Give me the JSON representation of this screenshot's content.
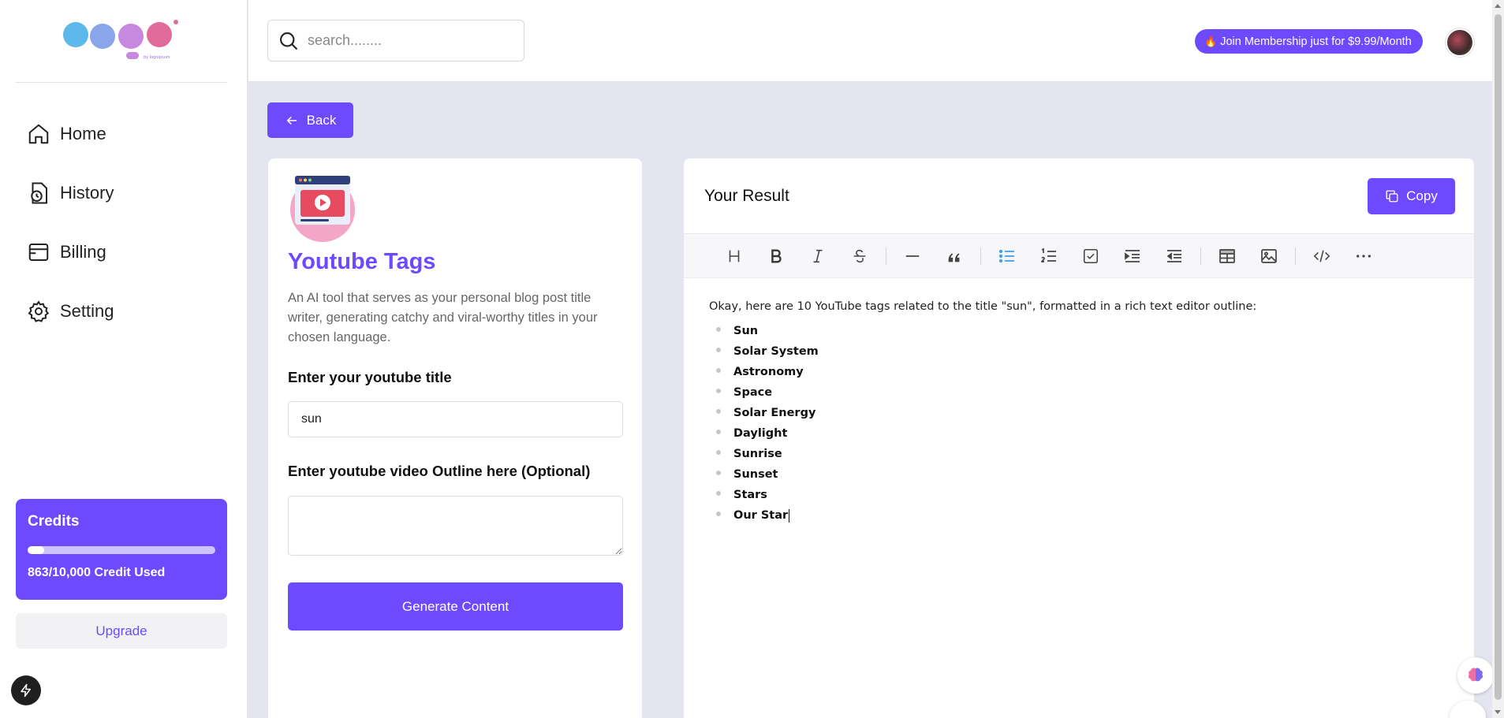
{
  "app": {
    "logo_text": "Logo",
    "logo_sub": "by logoipsum"
  },
  "sidebar": {
    "items": [
      {
        "label": "Home",
        "icon": "home-icon"
      },
      {
        "label": "History",
        "icon": "history-icon"
      },
      {
        "label": "Billing",
        "icon": "billing-icon"
      },
      {
        "label": "Setting",
        "icon": "gear-icon"
      }
    ],
    "credits": {
      "title": "Credits",
      "used_text": "863/10,000 Credit Used",
      "fraction_used": 0.0863
    },
    "upgrade_label": "Upgrade"
  },
  "topbar": {
    "search_placeholder": "search........",
    "membership_label": "Join Membership just for $9.99/Month"
  },
  "back_label": "Back",
  "tool": {
    "title": "Youtube Tags",
    "description": "An AI tool that serves as your personal blog post title writer, generating catchy and viral-worthy titles in your chosen language.",
    "title_field_label": "Enter your youtube title",
    "title_field_value": "sun",
    "outline_field_label": "Enter youtube video Outline here (Optional)",
    "outline_field_value": "",
    "generate_label": "Generate Content"
  },
  "result": {
    "title": "Your Result",
    "copy_label": "Copy",
    "toolbar": [
      "heading-icon",
      "bold-icon",
      "italic-icon",
      "strikethrough-icon",
      "horizontal-rule-icon",
      "quote-icon",
      "bullet-list-icon",
      "ordered-list-icon",
      "task-list-icon",
      "indent-icon",
      "outdent-icon",
      "table-icon",
      "image-icon",
      "code-icon",
      "more-icon"
    ],
    "active_tool": "bullet-list-icon",
    "intro": "Okay, here are 10 YouTube tags related to the title \"sun\", formatted in a rich text editor outline:",
    "tags": [
      "Sun",
      "Solar System",
      "Astronomy",
      "Space",
      "Solar Energy",
      "Daylight",
      "Sunrise",
      "Sunset",
      "Stars",
      "Our Star"
    ]
  },
  "colors": {
    "accent": "#6d4aff",
    "background": "#e3e6ee",
    "active_tool": "#3aa0f0"
  }
}
